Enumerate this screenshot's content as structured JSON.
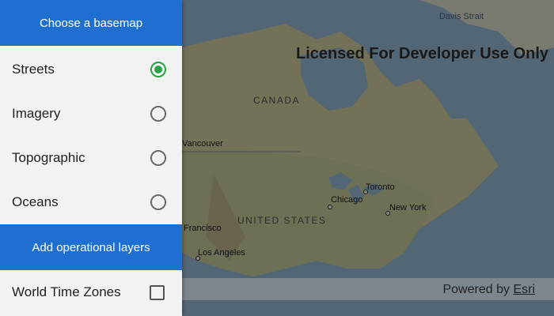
{
  "drawer": {
    "basemap_header": "Choose a basemap",
    "basemaps": [
      {
        "label": "Streets",
        "selected": true
      },
      {
        "label": "Imagery",
        "selected": false
      },
      {
        "label": "Topographic",
        "selected": false
      },
      {
        "label": "Oceans",
        "selected": false
      }
    ],
    "layers_header": "Add operational layers",
    "layers": [
      {
        "label": "World Time Zones",
        "checked": false
      }
    ]
  },
  "map": {
    "license_text": "Licensed For Developer Use Only",
    "powered_by": "Powered by",
    "esri": "Esri",
    "labels": {
      "davis_strait": "Davis Strait",
      "canada": "CANADA",
      "vancouver": "Vancouver",
      "united_states": "UNITED STATES",
      "chicago": "Chicago",
      "toronto": "Toronto",
      "new_york": "New York",
      "san_francisco": "Francisco",
      "los_angeles": "Los Angeles"
    }
  },
  "colors": {
    "header_blue": "#1f6fd1",
    "radio_selected_green": "#29a34a"
  }
}
